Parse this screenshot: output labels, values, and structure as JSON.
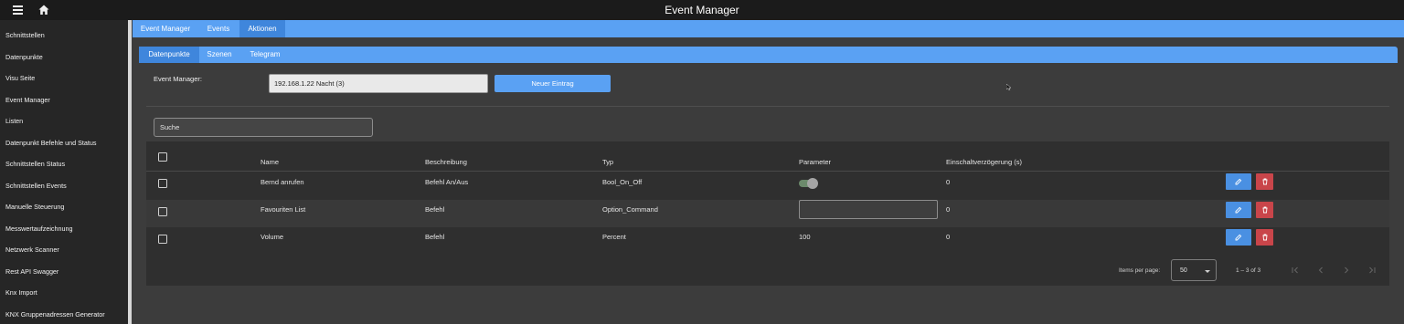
{
  "app": {
    "title": "Event Manager"
  },
  "topbar": {
    "menu_icon": "menu-icon",
    "home_icon": "home-icon"
  },
  "sidebar": {
    "items": [
      {
        "label": "Schnittstellen"
      },
      {
        "label": "Datenpunkte"
      },
      {
        "label": "Visu Seite"
      },
      {
        "label": "Event Manager"
      },
      {
        "label": "Listen"
      },
      {
        "label": "Datenpunkt Befehle und Status"
      },
      {
        "label": "Schnittstellen Status"
      },
      {
        "label": "Schnittstellen Events"
      },
      {
        "label": "Manuelle Steuerung"
      },
      {
        "label": "Messwertaufzeichnung"
      },
      {
        "label": "Netzwerk Scanner"
      },
      {
        "label": "Rest API Swagger"
      },
      {
        "label": "Knx Import"
      },
      {
        "label": "KNX Gruppenadressen Generator"
      }
    ]
  },
  "main_tabs": [
    {
      "label": "Event Manager",
      "active": false
    },
    {
      "label": "Events",
      "active": false
    },
    {
      "label": "Aktionen",
      "active": true
    }
  ],
  "sub_tabs": [
    {
      "label": "Datenpunkte",
      "active": true
    },
    {
      "label": "Szenen",
      "active": false
    },
    {
      "label": "Telegram",
      "active": false
    }
  ],
  "event_manager": {
    "label": "Event Manager:",
    "selected": "192.168.1.22 Nacht (3)",
    "new_button": "Neuer Eintrag"
  },
  "search": {
    "placeholder": "Suche"
  },
  "table": {
    "headers": {
      "name": "Name",
      "beschreibung": "Beschreibung",
      "typ": "Typ",
      "parameter": "Parameter",
      "delay": "Einschaltverzögerung (s)"
    },
    "rows": [
      {
        "name": "Bernd anrufen",
        "beschreibung": "Befehl An/Aus",
        "typ": "Bool_On_Off",
        "parameter_kind": "toggle",
        "parameter": "",
        "delay": "0"
      },
      {
        "name": "Favouriten List",
        "beschreibung": "Befehl",
        "typ": "Option_Command",
        "parameter_kind": "input",
        "parameter": "",
        "delay": "0"
      },
      {
        "name": "Volume",
        "beschreibung": "Befehl",
        "typ": "Percent",
        "parameter_kind": "text",
        "parameter": "100",
        "delay": "0"
      }
    ]
  },
  "paginator": {
    "items_per_page_label": "Items per page:",
    "page_size": "50",
    "range": "1 – 3 of 3"
  },
  "colors": {
    "accent": "#5aa1f3",
    "accent_active": "#3f86dc",
    "edit": "#4a90e2",
    "delete": "#c9454a"
  }
}
